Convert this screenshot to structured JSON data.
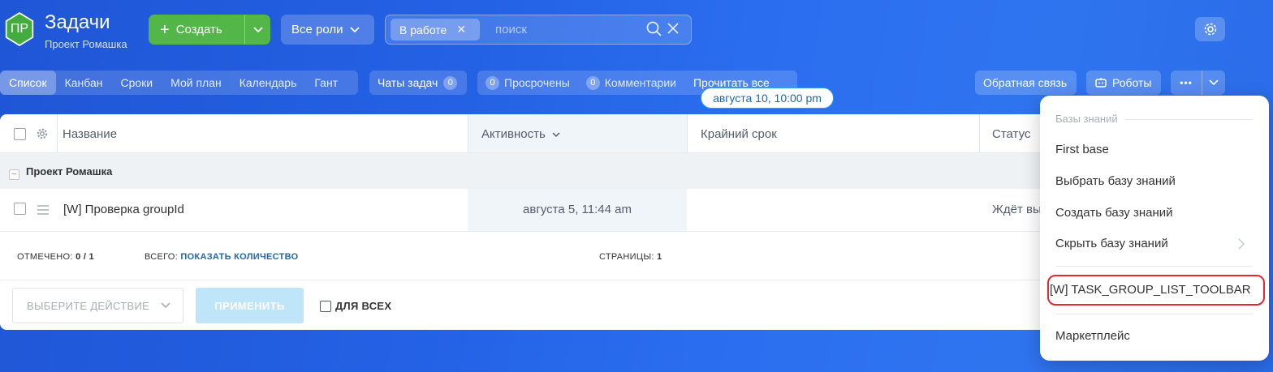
{
  "header": {
    "logo_text": "ПР",
    "title": "Задачи",
    "subtitle": "Проект Ромашка",
    "create_label": "Создать",
    "roles_label": "Все роли",
    "filter_chip": "В работе",
    "search_placeholder": "поиск"
  },
  "views": [
    "Список",
    "Канбан",
    "Сроки",
    "Мой план",
    "Календарь",
    "Гант"
  ],
  "toolbar": {
    "chats_label": "Чаты задач",
    "chats_count": "0",
    "overdue_count": "0",
    "overdue_label": "Просрочены",
    "comments_count": "0",
    "comments_label": "Комментарии",
    "read_all_label": "Прочитать все",
    "feedback_label": "Обратная связь",
    "robots_label": "Роботы",
    "more_label": "•••"
  },
  "table": {
    "columns": {
      "name": "Название",
      "activity": "Активность",
      "deadline": "Крайний срок",
      "status": "Статус"
    },
    "group_name": "Проект Ромашка",
    "rows": [
      {
        "name": "[W] Проверка groupId",
        "activity": "августа 5, 11:44 am",
        "deadline": "августа 10, 10:00 pm",
        "status": "Ждёт вы"
      }
    ],
    "footer": {
      "checked_label": "ОТМЕЧЕНО:",
      "checked_value": "0 / 1",
      "total_label": "ВСЕГО:",
      "total_link": "ПОКАЗАТЬ КОЛИЧЕСТВО",
      "pages_label": "СТРАНИЦЫ:",
      "pages_value": "1"
    },
    "actions": {
      "select_placeholder": "ВЫБЕРИТЕ ДЕЙСТВИЕ",
      "apply_label": "ПРИМЕНИТЬ",
      "for_all_label": "ДЛЯ ВСЕХ"
    }
  },
  "menu": {
    "section_title": "Базы знаний",
    "items": [
      "First base",
      "Выбрать базу знаний",
      "Создать базу знаний",
      "Скрыть базу знаний"
    ],
    "highlighted_item": "[W] TASK_GROUP_LIST_TOOLBAR",
    "marketplace": "Маркетплейс"
  },
  "colors": {
    "accent_green": "#52b748",
    "highlight_red": "#e8262f",
    "link_blue": "#2067b0"
  }
}
